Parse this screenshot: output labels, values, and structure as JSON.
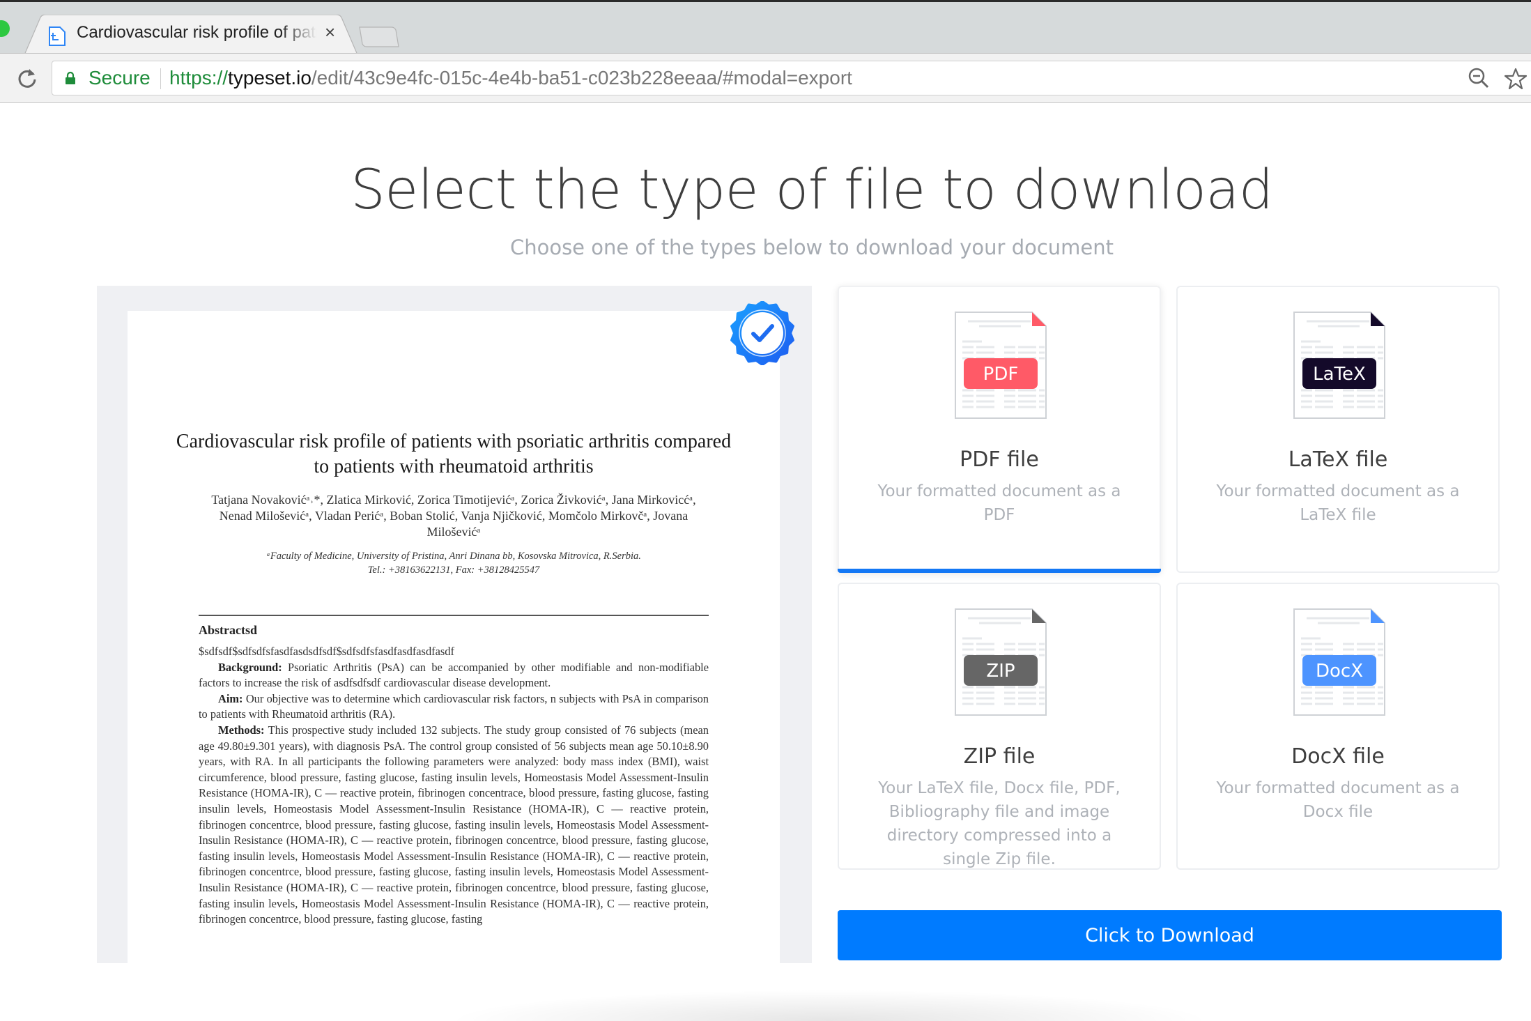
{
  "browser": {
    "tab_title": "Cardiovascular risk profile of patients",
    "tab_close": "×",
    "secure_label": "Secure",
    "url_scheme": "https://",
    "url_host": "typeset.io",
    "url_path": "/edit/43c9e4fc-015c-4e4b-ba51-c023b228eeaa/#modal=export",
    "icons": [
      "reload-icon",
      "lock-icon",
      "zoom-out-icon",
      "bookmark-star-icon"
    ]
  },
  "header": {
    "title": "Select the type of file to download",
    "subtitle": "Choose one of the types below to download your document"
  },
  "preview": {
    "verified_badge": "verified-check-icon",
    "paper_title": "Cardiovascular risk profile of patients with psoriatic arthritis compared to patients with rheumatoid arthritis",
    "authors": "Tatjana Novakovićᵃ˒*, Zlatica Mirković, Zorica Timotijevićᵃ, Zorica Živkovićᵃ, Jana Mirkovicćᵃ, Nenad Miloševićᵃ, Vladan Perićᵃ, Boban Stolić, Vanja Njičković, Momčolo Mirkovčᵃ, Jovana Miloševićᵃ",
    "affiliation_line1": "ᵃFaculty of Medicine, University of Pristina, Anri Dinana bb, Kosovska Mitrovica, R.Serbia.",
    "affiliation_line2": "Tel.: +38163622131, Fax: +38128425547",
    "abstract_heading": "Abstractsd",
    "abstract_junk": "$sdfsdf$sdfsdfsfasdfasdsdfsdf$sdfsdfsfasdfasdfasdfasdf",
    "background_label": "Background:",
    "background_text": " Psoriatic Arthritis (PsA) can be accompanied by other modifiable and non-modifiable factors to increase the risk of asdfsdfsdf cardiovascular disease development.",
    "aim_label": "Aim:",
    "aim_text": " Our objective was to determine which cardiovascular risk factors, n subjects with PsA in comparison to patients with Rheumatoid arthritis (RA).",
    "methods_label": "Methods:",
    "methods_text": " This prospective study included 132 subjects. The study group consisted of 76 subjects (mean age 49.80±9.301 years), with diagnosis PsA. The control group consisted of 56 subjects mean age 50.10±8.90 years, with RA. In all participants the following parameters were analyzed: body mass index (BMI), waist circumference, blood pressure, fasting glucose, fasting insulin levels, Homeostasis Model Assessment-Insulin Resistance (HOMA-IR), C — reactive protein, fibrinogen concentrace, blood pressure, fasting glucose, fasting insulin levels, Homeostasis Model Assessment-Insulin Resistance (HOMA-IR), C — reactive protein, fibrinogen concentrce, blood pressure, fasting glucose, fasting insulin levels, Homeostasis Model Assessment-Insulin Resistance (HOMA-IR), C — reactive protein, fibrinogen concentrce, blood pressure, fasting glucose, fasting insulin levels, Homeostasis Model Assessment-Insulin Resistance (HOMA-IR), C — reactive protein, fibrinogen concentrce, blood pressure, fasting glucose, fasting insulin levels, Homeostasis Model Assessment-Insulin Resistance (HOMA-IR), C — reactive protein, fibrinogen concentrce, blood pressure, fasting glucose, fasting insulin levels, Homeostasis Model Assessment-Insulin Resistance (HOMA-IR), C — reactive protein, fibrinogen concentrce, blood pressure, fasting glucose, fasting"
  },
  "options": [
    {
      "id": "pdf",
      "badge": "PDF",
      "title": "PDF file",
      "description": "Your formatted document as a PDF",
      "badge_color": "#ff5a67",
      "corner_color": "#ff5a67",
      "selected": true
    },
    {
      "id": "latex",
      "badge": "LaTeX",
      "title": "LaTeX file",
      "description": "Your formatted document as a LaTeX file",
      "badge_color": "#140a2a",
      "corner_color": "#140a2a",
      "selected": false
    },
    {
      "id": "zip",
      "badge": "ZIP",
      "title": "ZIP file",
      "description": "Your LaTeX file, Docx file, PDF, Bibliography file and image directory compressed into a single Zip file.",
      "badge_color": "#666666",
      "corner_color": "#666666",
      "selected": false
    },
    {
      "id": "docx",
      "badge": "DocX",
      "title": "DocX file",
      "description": "Your formatted document as a Docx file",
      "badge_color": "#4d94ff",
      "corner_color": "#4d94ff",
      "selected": false
    }
  ],
  "actions": {
    "download_label": "Click to Download",
    "download_color": "#007bff"
  }
}
